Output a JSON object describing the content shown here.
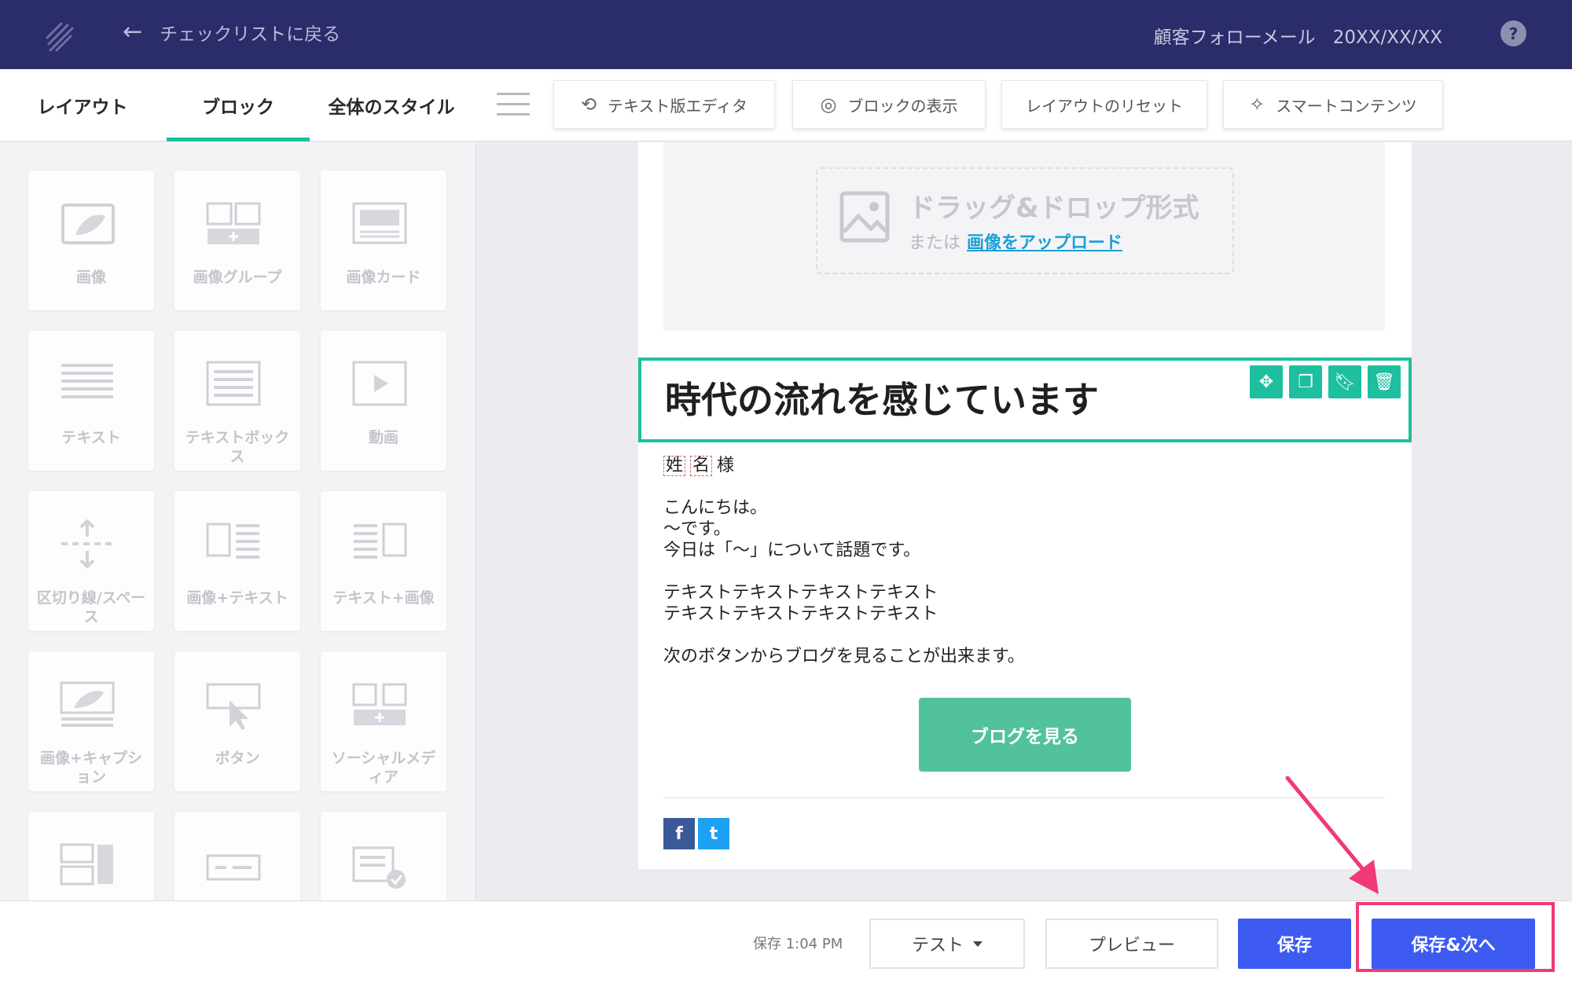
{
  "topbar": {
    "back_label": "チェックリストに戻る",
    "campaign_name": "顧客フォローメール",
    "campaign_date": "20XX/XX/XX",
    "help_label": "?"
  },
  "tabs": [
    {
      "label": "レイアウト",
      "active": false
    },
    {
      "label": "ブロック",
      "active": true
    },
    {
      "label": "全体のスタイル",
      "active": false
    }
  ],
  "tools": {
    "text_editor": "テキスト版エディタ",
    "show_blocks": "ブロックの表示",
    "reset_layout": "レイアウトのリセット",
    "smart_content": "スマートコンテンツ"
  },
  "blocks": [
    {
      "label": "画像",
      "icon": "image-icon"
    },
    {
      "label": "画像グループ",
      "icon": "image-group-icon"
    },
    {
      "label": "画像カード",
      "icon": "image-card-icon"
    },
    {
      "label": "テキスト",
      "icon": "text-icon"
    },
    {
      "label": "テキストボックス",
      "icon": "text-box-icon"
    },
    {
      "label": "動画",
      "icon": "video-icon"
    },
    {
      "label": "区切り線/スペース",
      "icon": "divider-icon"
    },
    {
      "label": "画像+テキスト",
      "icon": "image-text-icon"
    },
    {
      "label": "テキスト+画像",
      "icon": "text-image-icon"
    },
    {
      "label": "画像+キャプション",
      "icon": "image-caption-icon"
    },
    {
      "label": "ボタン",
      "icon": "button-icon"
    },
    {
      "label": "ソーシャルメディア",
      "icon": "social-media-icon"
    },
    {
      "label": "",
      "icon": "social-follow-icon"
    },
    {
      "label": "",
      "icon": "navigation-icon"
    },
    {
      "label": "",
      "icon": "survey-icon"
    }
  ],
  "canvas": {
    "dropzone_title": "ドラッグ&ドロップ形式",
    "dropzone_or": "または",
    "dropzone_upload": "画像をアップロード",
    "headline": "時代の流れを感じています",
    "merge_last": "姓",
    "merge_first": "名",
    "salutation": "様",
    "lines": [
      "こんにちは。",
      "〜です。",
      "今日は「〜」について話題です。",
      "テキストテキストテキストテキスト",
      "テキストテキストテキストテキスト",
      "次のボタンからブログを見ることが出来ます。"
    ],
    "cta_label": "ブログを見る",
    "social_facebook": "f",
    "social_twitter": "t"
  },
  "bottombar": {
    "saved_status": "保存 1:04 PM",
    "test_label": "テスト",
    "preview_label": "プレビュー",
    "save_label": "保存",
    "save_next_label": "保存&次へ"
  },
  "colors": {
    "topbar": "#2b2c6a",
    "accent": "#1dbf9f",
    "primary": "#3d5bf0",
    "cta": "#52c29a",
    "annotation": "#f03a78"
  }
}
